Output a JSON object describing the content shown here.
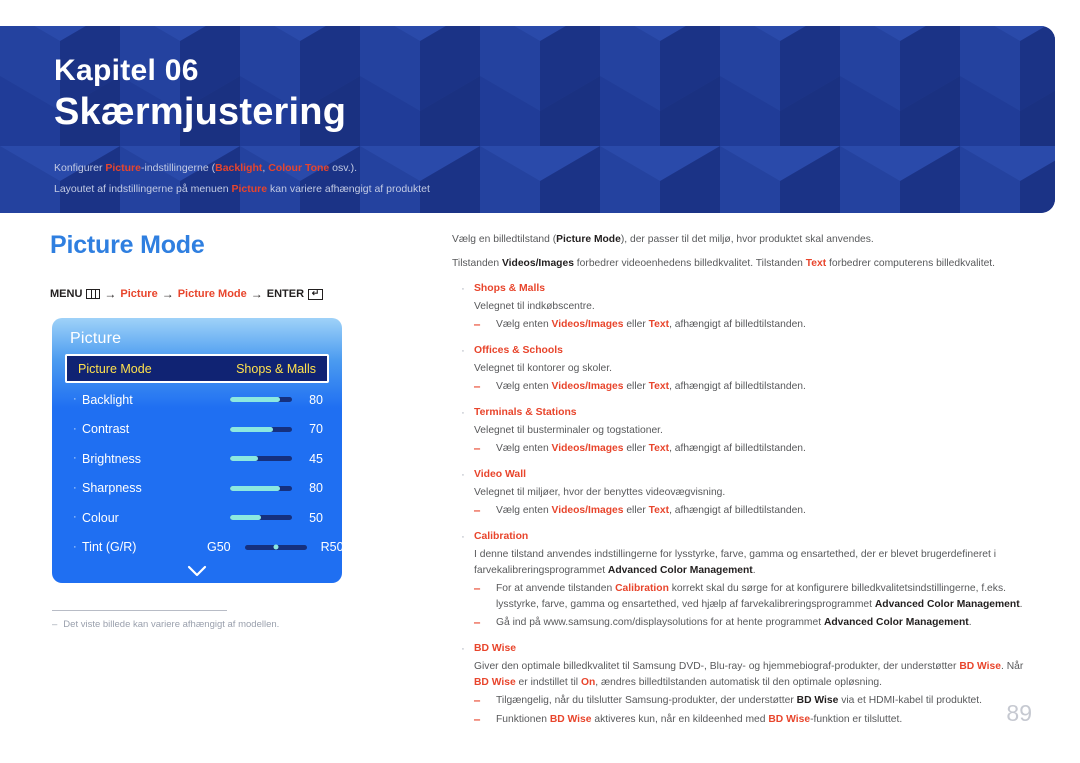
{
  "banner": {
    "chapter_kicker": "Kapitel 06",
    "chapter_title": "Skærmjustering",
    "sub_line1_a": "Konfigurer ",
    "sub_line1_kw1": "Picture",
    "sub_line1_b": "-indstillingerne (",
    "sub_line1_kw2": "Backlight",
    "sub_line1_c": ", ",
    "sub_line1_kw3": "Colour Tone",
    "sub_line1_d": " osv.).",
    "sub_line2_a": "Layoutet af indstillingerne på menuen ",
    "sub_line2_kw1": "Picture",
    "sub_line2_b": " kan variere afhængigt af produktet",
    "bg_color": "#1f3a93"
  },
  "section": {
    "title": "Picture Mode",
    "title_color": "#2f7fe0"
  },
  "menu_path": {
    "menu_label": "MENU",
    "menu_icon": "menu-bars-icon",
    "arrow": "→",
    "item1": "Picture",
    "item2": "Picture Mode",
    "enter_label": "ENTER",
    "enter_icon": "enter-key-icon"
  },
  "osd": {
    "title": "Picture",
    "selected_row": {
      "label": "Picture Mode",
      "value": "Shops & Malls"
    },
    "rows": [
      {
        "label": "Backlight",
        "value": "80",
        "percent": 80
      },
      {
        "label": "Contrast",
        "value": "70",
        "percent": 70
      },
      {
        "label": "Brightness",
        "value": "45",
        "percent": 45
      },
      {
        "label": "Sharpness",
        "value": "80",
        "percent": 80
      },
      {
        "label": "Colour",
        "value": "50",
        "percent": 50
      }
    ],
    "tint_row": {
      "label": "Tint (G/R)",
      "left": "G50",
      "right": "R50"
    },
    "chevron_icon": "chevron-down-icon"
  },
  "footnote": {
    "dash": "‒",
    "text": "Det viste billede kan variere afhængigt af modellen."
  },
  "right": {
    "intro1_a": "Vælg en billedtilstand (",
    "intro1_kw": "Picture Mode",
    "intro1_b": "), der passer til det miljø, hvor produktet skal anvendes.",
    "intro2_a": "Tilstanden ",
    "intro2_kw1": "Videos/Images",
    "intro2_b": " forbedrer videoenhedens billedkvalitet. Tilstanden ",
    "intro2_kw2": "Text",
    "intro2_c": " forbedrer computerens billedkvalitet.",
    "bullet_dot": "·",
    "sub_dash": "‒",
    "common_sub_a": "Vælg enten ",
    "common_sub_kw1": "Videos/Images",
    "common_sub_b": " eller ",
    "common_sub_kw2": "Text",
    "common_sub_c": ", afhængigt af billedtilstanden.",
    "items": [
      {
        "head": "Shops & Malls",
        "body": "Velegnet til indkøbscentre."
      },
      {
        "head": "Offices & Schools",
        "body": "Velegnet til kontorer og skoler."
      },
      {
        "head": "Terminals & Stations",
        "body": "Velegnet til busterminaler og togstationer."
      },
      {
        "head": "Video Wall",
        "body": "Velegnet til miljøer, hvor der benyttes videovægvisning."
      }
    ],
    "calibration": {
      "head": "Calibration",
      "body_a": "I denne tilstand anvendes indstillingerne for lysstyrke, farve, gamma og ensartethed, der er blevet brugerdefineret i farvekalibreringsprogrammet ",
      "body_bk": "Advanced Color Management",
      "body_b": ".",
      "sub1_a": "For at anvende tilstanden ",
      "sub1_kw": "Calibration",
      "sub1_b": " korrekt skal du sørge for at konfigurere billedkvalitetsindstillingerne, f.eks. lysstyrke, farve, gamma og ensartethed, ved hjælp af farvekalibreringsprogrammet ",
      "sub1_bk": "Advanced Color Management",
      "sub1_c": ".",
      "sub2_a": "Gå ind på www.samsung.com/displaysolutions for at hente programmet ",
      "sub2_bk": "Advanced Color Management",
      "sub2_b": "."
    },
    "bdwise": {
      "head": "BD Wise",
      "body_a": "Giver den optimale billedkvalitet til Samsung DVD-, Blu-ray- og hjemmebiograf-produkter, der understøtter ",
      "body_kw1": "BD Wise",
      "body_b": ". Når ",
      "body_kw2": "BD Wise",
      "body_c": " er indstillet til ",
      "body_kw3": "On",
      "body_d": ", ændres billedtilstanden automatisk til den optimale opløsning.",
      "sub1_a": "Tilgængelig, når du tilslutter Samsung-produkter, der understøtter ",
      "sub1_kw": "BD Wise",
      "sub1_b": " via et HDMI-kabel til produktet.",
      "sub2_a": "Funktionen ",
      "sub2_kw1": "BD Wise",
      "sub2_b": " aktiveres kun, når en kildeenhed med ",
      "sub2_kw2": "BD Wise",
      "sub2_c": "-funktion er tilsluttet."
    }
  },
  "page_number": "89",
  "colors": {
    "accent_red": "#e8452c",
    "banner_blue": "#1f3a93",
    "heading_blue": "#2f7fe0",
    "osd_blue": "#1f6ff2",
    "osd_selected": "#102373",
    "osd_yellow": "#ffe14d",
    "slider_fill": "#8ce8e0"
  }
}
